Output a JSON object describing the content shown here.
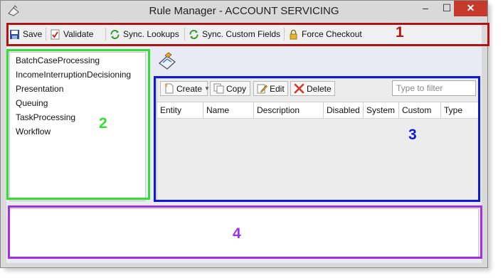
{
  "window": {
    "title": "Rule Manager - ACCOUNT SERVICING",
    "minimize_glyph": "–",
    "maximize_glyph": "☐",
    "close_glyph": "✕"
  },
  "toolbar": {
    "save_label": "Save",
    "validate_label": "Validate",
    "sync_lookups_label": "Sync. Lookups",
    "sync_custom_fields_label": "Sync. Custom Fields",
    "force_checkout_label": "Force Checkout"
  },
  "tree": {
    "items": [
      {
        "label": "BatchCaseProcessing"
      },
      {
        "label": "IncomeInterruptionDecisioning"
      },
      {
        "label": "Presentation"
      },
      {
        "label": "Queuing"
      },
      {
        "label": "TaskProcessing"
      },
      {
        "label": "Workflow"
      }
    ]
  },
  "grid": {
    "create_label": "Create",
    "copy_label": "Copy",
    "edit_label": "Edit",
    "delete_label": "Delete",
    "filter_placeholder": "Type to filter",
    "columns": [
      "Entity",
      "Name",
      "Description",
      "Disabled",
      "System",
      "Custom",
      "Type"
    ]
  },
  "callouts": {
    "one": "1",
    "two": "2",
    "three": "3",
    "four": "4"
  },
  "colors": {
    "callout_1": "#b01414",
    "callout_2": "#33dd33",
    "callout_3": "#0a1ad8",
    "callout_4": "#a030e8",
    "close_button": "#c7392b"
  }
}
